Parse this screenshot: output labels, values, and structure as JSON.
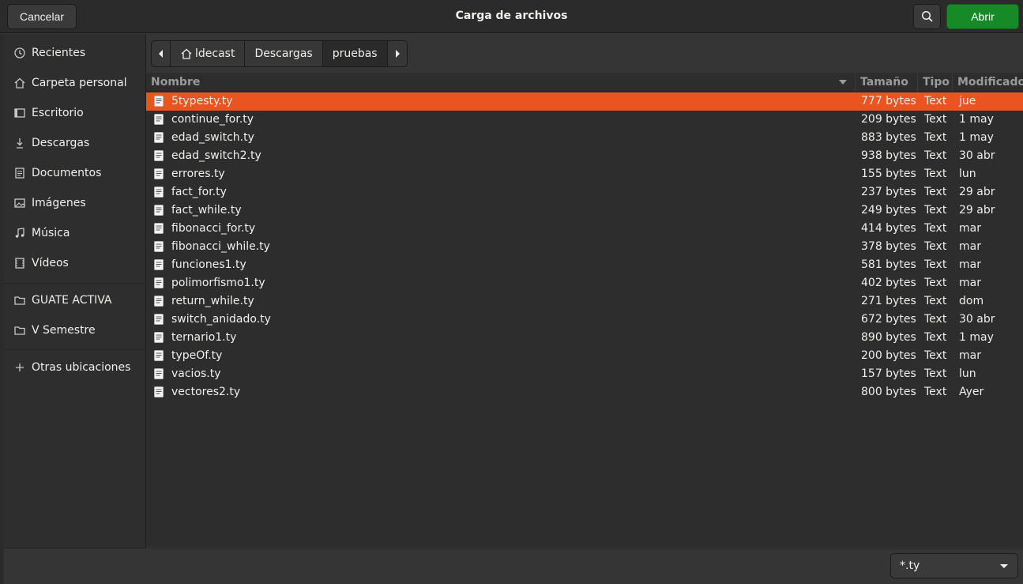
{
  "header": {
    "cancel_label": "Cancelar",
    "title": "Carga de archivos",
    "open_label": "Abrir",
    "open_color": "#158a26"
  },
  "sidebar": {
    "items": [
      {
        "label": "Recientes",
        "icon": "clock-icon"
      },
      {
        "label": "Carpeta personal",
        "icon": "home-icon"
      },
      {
        "label": "Escritorio",
        "icon": "desktop-icon"
      },
      {
        "label": "Descargas",
        "icon": "download-icon"
      },
      {
        "label": "Documentos",
        "icon": "document-icon"
      },
      {
        "label": "Imágenes",
        "icon": "image-icon"
      },
      {
        "label": "Música",
        "icon": "music-icon"
      },
      {
        "label": "Vídeos",
        "icon": "video-icon"
      }
    ],
    "bookmarks": [
      {
        "label": "GUATE ACTIVA",
        "icon": "folder-icon"
      },
      {
        "label": "V Semestre",
        "icon": "folder-icon"
      }
    ],
    "other_locations": {
      "label": "Otras ubicaciones",
      "icon": "plus-icon"
    }
  },
  "pathbar": {
    "segments": [
      "ldecast",
      "Descargas",
      "pruebas"
    ]
  },
  "columns": {
    "name": "Nombre",
    "size": "Tamaño",
    "type": "Tipo",
    "modified": "Modificado"
  },
  "selection_color": "#e95420",
  "files": [
    {
      "name": "5typesty.ty",
      "size": "777 bytes",
      "type": "Text",
      "modified": "jue",
      "selected": true
    },
    {
      "name": "continue_for.ty",
      "size": "209 bytes",
      "type": "Text",
      "modified": "1 may"
    },
    {
      "name": "edad_switch.ty",
      "size": "883 bytes",
      "type": "Text",
      "modified": "1 may"
    },
    {
      "name": "edad_switch2.ty",
      "size": "938 bytes",
      "type": "Text",
      "modified": "30 abr"
    },
    {
      "name": "errores.ty",
      "size": "155 bytes",
      "type": "Text",
      "modified": "lun"
    },
    {
      "name": "fact_for.ty",
      "size": "237 bytes",
      "type": "Text",
      "modified": "29 abr"
    },
    {
      "name": "fact_while.ty",
      "size": "249 bytes",
      "type": "Text",
      "modified": "29 abr"
    },
    {
      "name": "fibonacci_for.ty",
      "size": "414 bytes",
      "type": "Text",
      "modified": "mar"
    },
    {
      "name": "fibonacci_while.ty",
      "size": "378 bytes",
      "type": "Text",
      "modified": "mar"
    },
    {
      "name": "funciones1.ty",
      "size": "581 bytes",
      "type": "Text",
      "modified": "mar"
    },
    {
      "name": "polimorfismo1.ty",
      "size": "402 bytes",
      "type": "Text",
      "modified": "mar"
    },
    {
      "name": "return_while.ty",
      "size": "271 bytes",
      "type": "Text",
      "modified": "dom"
    },
    {
      "name": "switch_anidado.ty",
      "size": "672 bytes",
      "type": "Text",
      "modified": "30 abr"
    },
    {
      "name": "ternario1.ty",
      "size": "890 bytes",
      "type": "Text",
      "modified": "1 may"
    },
    {
      "name": "typeOf.ty",
      "size": "200 bytes",
      "type": "Text",
      "modified": "mar"
    },
    {
      "name": "vacios.ty",
      "size": "157 bytes",
      "type": "Text",
      "modified": "lun"
    },
    {
      "name": "vectores2.ty",
      "size": "800 bytes",
      "type": "Text",
      "modified": "Ayer"
    }
  ],
  "filter": {
    "value": "*.ty"
  }
}
